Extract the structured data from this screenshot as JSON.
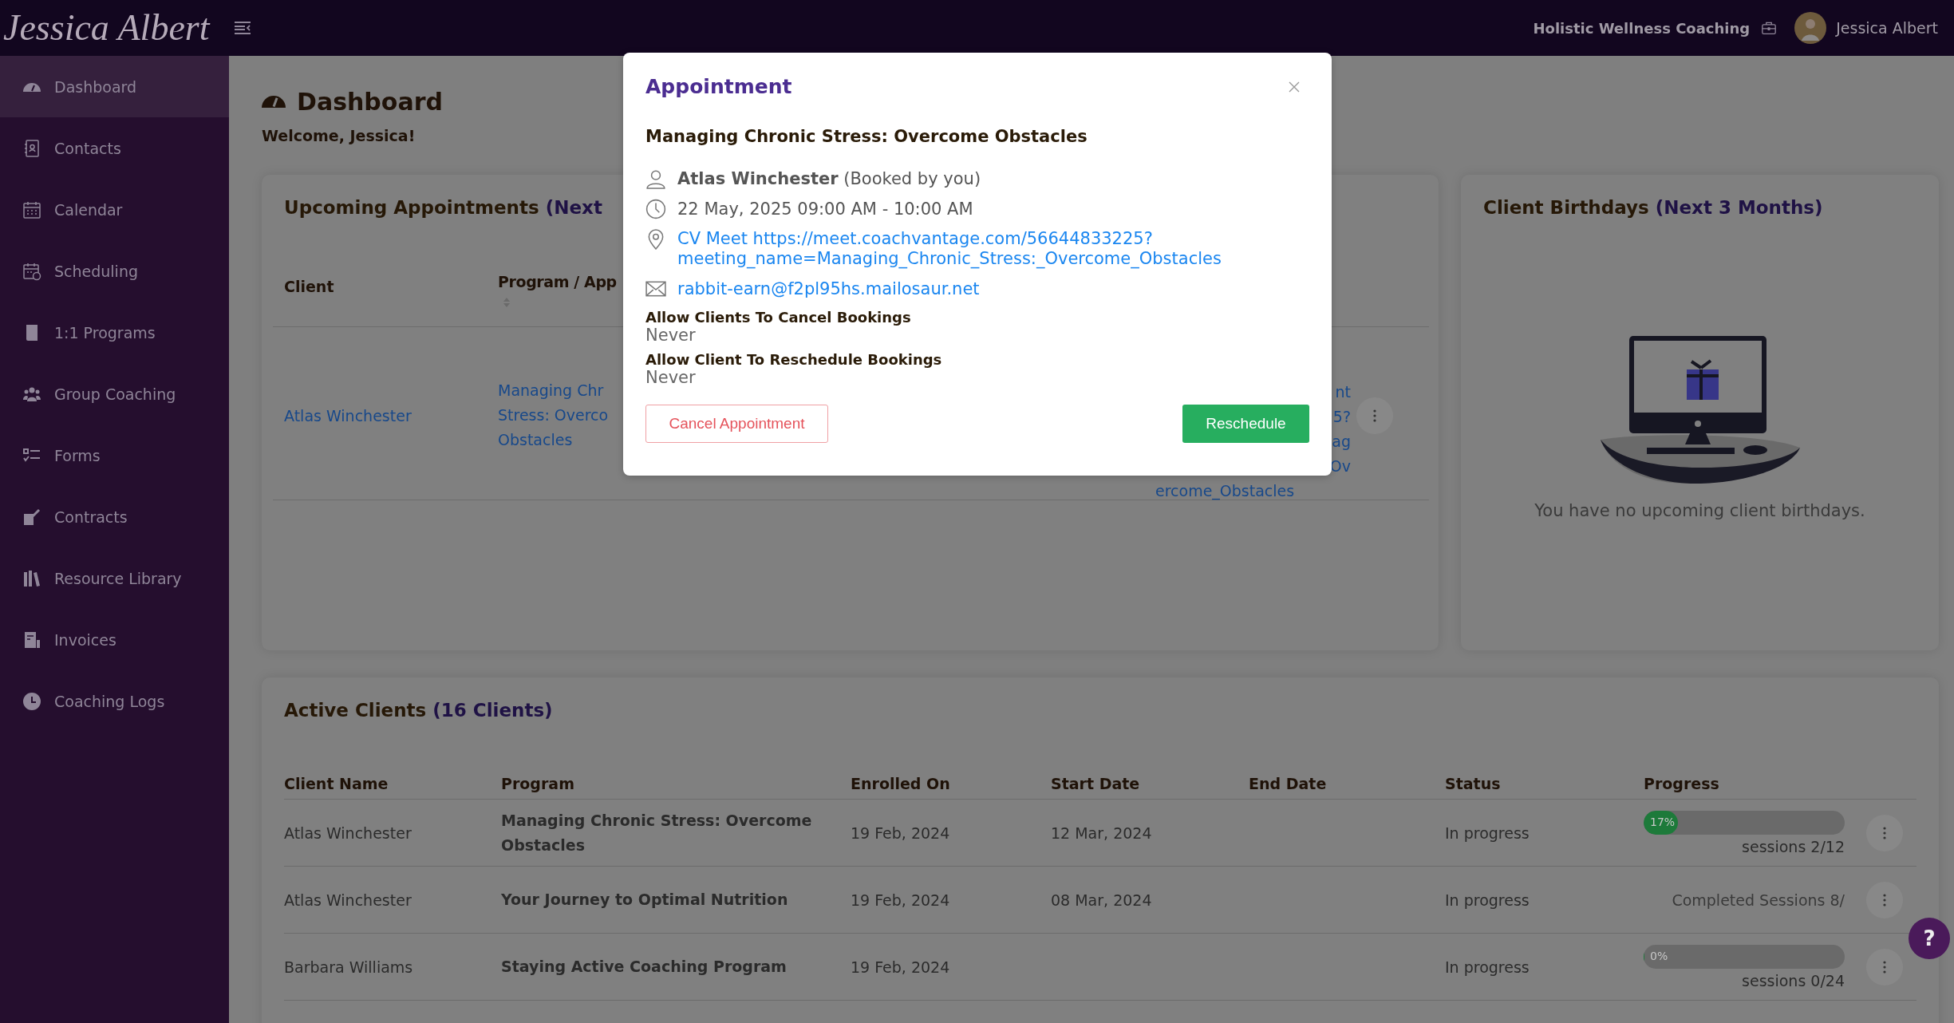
{
  "header": {
    "logo": "Jessica Albert",
    "business": "Holistic Wellness Coaching",
    "user": "Jessica Albert"
  },
  "sidebar": {
    "items": [
      {
        "label": "Dashboard",
        "selected": true
      },
      {
        "label": "Contacts",
        "selected": false
      },
      {
        "label": "Calendar",
        "selected": false
      },
      {
        "label": "Scheduling",
        "selected": false
      },
      {
        "label": "1:1 Programs",
        "selected": false
      },
      {
        "label": "Group Coaching",
        "selected": false
      },
      {
        "label": "Forms",
        "selected": false
      },
      {
        "label": "Contracts",
        "selected": false
      },
      {
        "label": "Resource Library",
        "selected": false
      },
      {
        "label": "Invoices",
        "selected": false
      },
      {
        "label": "Coaching Logs",
        "selected": false
      }
    ]
  },
  "page": {
    "title": "Dashboard",
    "welcome": "Welcome, Jessica!"
  },
  "upcoming": {
    "title": "Upcoming Appointments",
    "title_accent": "(Next",
    "columns": [
      "Client",
      "Program / App"
    ],
    "row": {
      "client": "Atlas Winchester",
      "program_lines": [
        "Managing Chr",
        "Stress: Overco",
        "Obstacles"
      ],
      "column_3_lines": [
        "nt",
        "5?",
        "ag",
        "Ov"
      ],
      "column_3_tail": "ercome_Obstacles"
    }
  },
  "birthdays": {
    "title": "Client Birthdays",
    "title_accent": "(Next 3 Months)",
    "empty_message": "You have no upcoming client birthdays."
  },
  "active_clients": {
    "title": "Active Clients",
    "title_accent": "(16 Clients)",
    "columns": [
      "Client Name",
      "Program",
      "Enrolled On",
      "Start Date",
      "End Date",
      "Status",
      "Progress"
    ],
    "rows": [
      {
        "client": "Atlas Winchester",
        "program": "Managing Chronic Stress: Overcome Obstacles",
        "enrolled_on": "19 Feb, 2024",
        "start_date": "12 Mar, 2024",
        "status": "In progress",
        "progress": {
          "kind": "bar",
          "level": 0.17,
          "label": "17%",
          "sessions": "sessions 2/12"
        }
      },
      {
        "client": "Atlas Winchester",
        "program": "Your Journey to Optimal Nutrition",
        "enrolled_on": "19 Feb, 2024",
        "start_date": "08 Mar, 2024",
        "status": "In progress",
        "progress": {
          "kind": "text",
          "text": "Completed Sessions 8/"
        }
      },
      {
        "client": "Barbara Williams",
        "program": "Staying Active Coaching Program",
        "enrolled_on": "19 Feb, 2024",
        "status": "In progress",
        "progress": {
          "kind": "bar",
          "level": 0,
          "label": "0%",
          "sessions": "sessions 0/24"
        }
      }
    ]
  },
  "help_button": "?",
  "modal": {
    "title": "Appointment",
    "program": "Managing Chronic Stress: Overcome Obstacles",
    "client": "Atlas Winchester",
    "booked_note": "(Booked by you)",
    "datetime": "22 May, 2025 09:00 AM - 10:00 AM",
    "location_lines": [
      "CV Meet https://meet.coachvantage.com/56644833225?",
      "meeting_name=Managing_Chronic_Stress:_Overcome_Obstacles"
    ],
    "email": "rabbit-earn@f2pl95hs.mailosaur.net",
    "settings": [
      {
        "label": "Allow Clients To Cancel Bookings",
        "value": "Never"
      },
      {
        "label": "Allow Client To Reschedule Bookings",
        "value": "Never"
      }
    ],
    "cancel_button": "Cancel Appointment",
    "reschedule_button": "Reschedule"
  }
}
